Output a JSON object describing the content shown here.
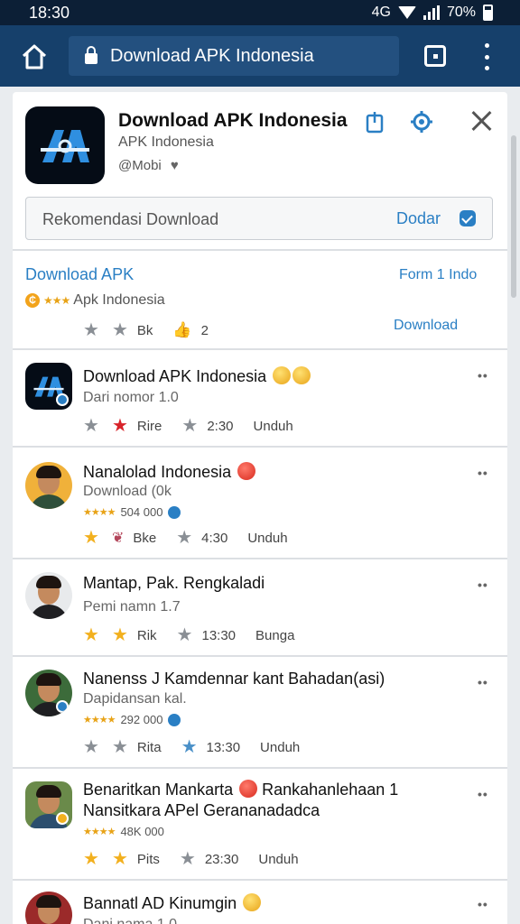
{
  "status_bar": {
    "time": "18:30",
    "network": "4G",
    "battery": "70%"
  },
  "browser": {
    "url": "Download APK Indonesia"
  },
  "app": {
    "title": "Download APK Indonesia",
    "subtitle": "APK Indonesia",
    "meta": "@Mobi"
  },
  "search": {
    "text": "Rekomendasi Download",
    "button": "Dodar"
  },
  "section": {
    "left_label": "Download APK",
    "right_label": "Form 1 Indo",
    "rating_text": "Apk Indonesia",
    "stat_1": "Bk",
    "stat_2": "2",
    "download_label": "Download"
  },
  "rows": [
    {
      "title": "Download APK Indonesia",
      "subtitle": "Dari nomor 1.0",
      "stat_1": "Rire",
      "stat_2": "2:30",
      "stat_3": "Unduh"
    },
    {
      "title": "Nanalolad Indonesia",
      "subtitle": "Download (0k",
      "rating": "504 000",
      "stat_1": "Bke",
      "stat_2": "4:30",
      "stat_3": "Unduh"
    },
    {
      "title": "Mantap, Pak. Rengkaladi",
      "subtitle": "Pemi namn 1.7",
      "stat_1": "Rik",
      "stat_2": "13:30",
      "stat_3": "Bunga"
    },
    {
      "title": "Nanenss J Kamdennar kant Bahadan(asi)",
      "subtitle": "Dapidansan kal.",
      "rating": "292 000",
      "stat_1": "Rita",
      "stat_2": "13:30",
      "stat_3": "Unduh"
    },
    {
      "title": "Benaritkan Mankarta",
      "title_b": "Rankahanlehaan 1",
      "subtitle": "Nansitkara APel Gerananadadca",
      "rating": "48K 000",
      "stat_1": "Pits",
      "stat_2": "23:30",
      "stat_3": "Unduh"
    },
    {
      "title": "Bannatl AD Kinumgin",
      "subtitle": "Dani nama 1.0"
    }
  ]
}
